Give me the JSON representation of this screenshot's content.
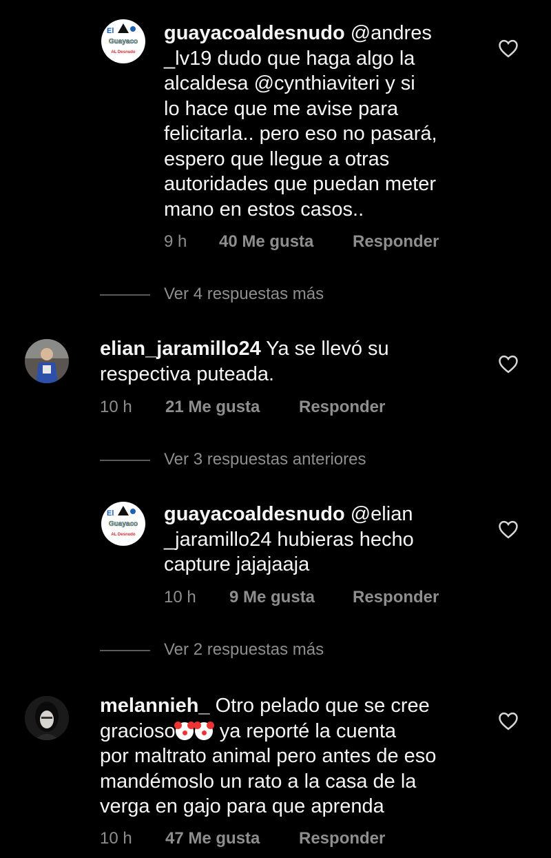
{
  "comments": [
    {
      "username": "guayacoaldesnudo",
      "lines": [
        "@andres",
        "_lv19 dudo que haga algo la",
        "alcaldesa @cynthiaviteri y si",
        "lo hace que me avise para",
        "felicitarla.. pero eso no pasará,",
        "espero que llegue a otras",
        "autoridades que puedan meter",
        "mano en estos casos.."
      ],
      "time": "9 h",
      "likes": "40 Me gusta",
      "reply": "Responder",
      "avatar": "guayaco-logo",
      "avatar_text": [
        "El",
        "Guayaco",
        "AL Desnudo"
      ]
    },
    {
      "username": "elian_jaramillo24",
      "lines": [
        "Ya se llevó su",
        "respectiva puteada."
      ],
      "time": "10 h",
      "likes": "21 Me gusta",
      "reply": "Responder",
      "avatar": "user-photo"
    },
    {
      "username": "guayacoaldesnudo",
      "lines": [
        "@elian",
        "_jaramillo24 hubieras hecho",
        "capture jajajaaja"
      ],
      "time": "10 h",
      "likes": "9 Me gusta",
      "reply": "Responder",
      "avatar": "guayaco-logo",
      "avatar_text": [
        "El",
        "Guayaco",
        "AL Desnudo"
      ]
    },
    {
      "username": "melannieh_",
      "lines": [
        "Otro pelado que se cree",
        "gracioso",
        "ya reporté la cuenta",
        "por maltrato animal pero antes de eso",
        "mandémoslo un rato a la casa de la",
        "verga en gajo para que aprenda"
      ],
      "time": "10 h",
      "likes": "47 Me gusta",
      "reply": "Responder",
      "avatar": "user-photo",
      "emoji": "clown-face-emoji"
    }
  ],
  "view_more": [
    "Ver 4 respuestas más",
    "Ver 3 respuestas anteriores",
    "Ver 2 respuestas más"
  ],
  "colors": {
    "background": "#000000",
    "text": "#f5f5f5",
    "meta": "#8e8e8e",
    "brand_red": "#d7262c",
    "brand_blue": "#1f5fb8"
  }
}
